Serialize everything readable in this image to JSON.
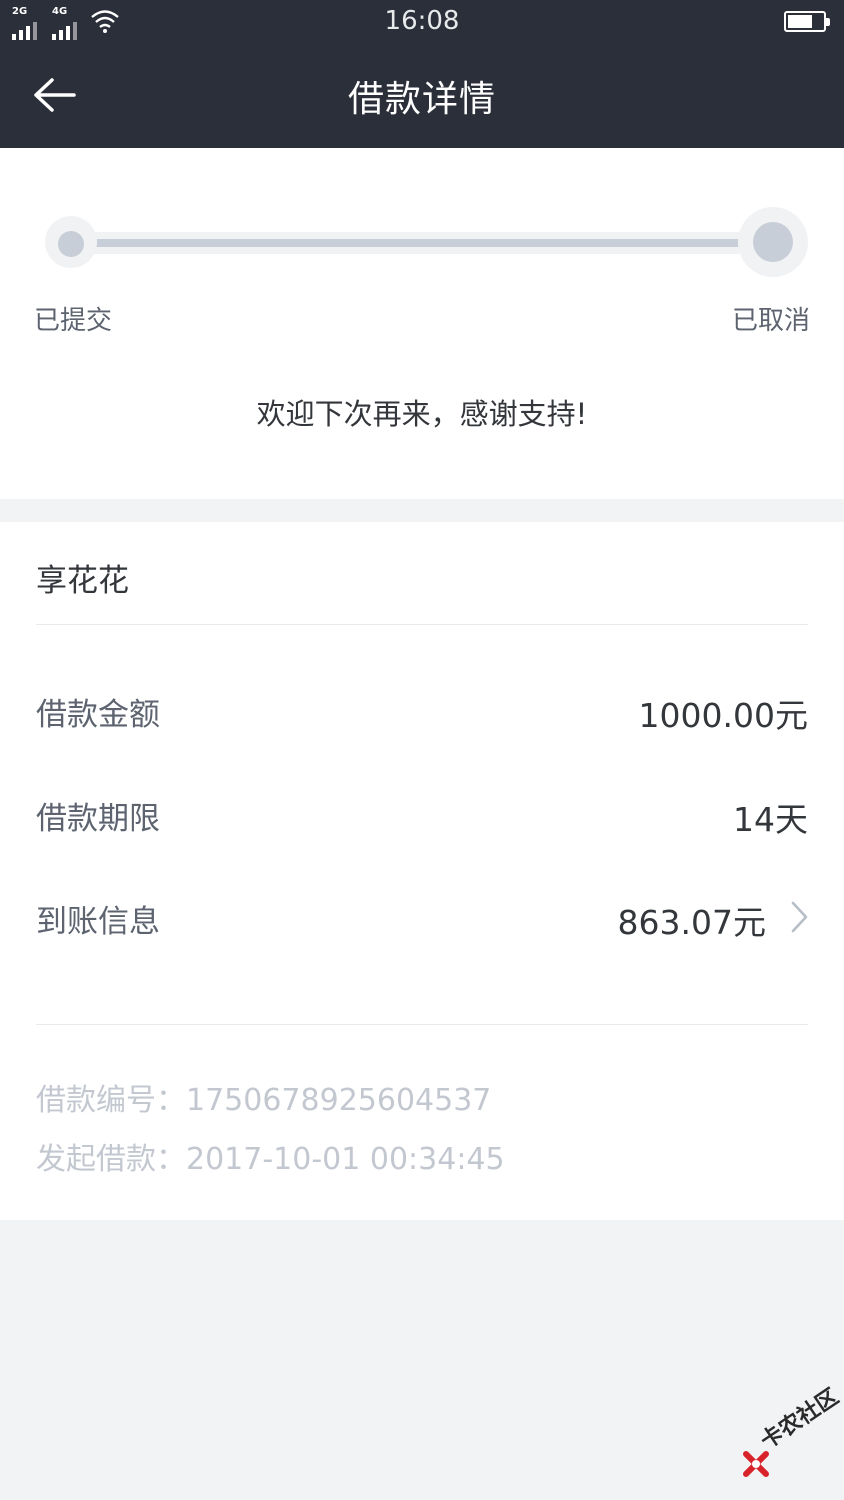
{
  "status_bar": {
    "signal_1_label": "2G",
    "signal_2_label": "4G",
    "time": "16:08",
    "icons": [
      "signal-icon",
      "signal-icon",
      "wifi-icon",
      "battery-icon"
    ]
  },
  "header": {
    "title": "借款详情",
    "back_icon": "back-arrow-icon"
  },
  "progress": {
    "steps": [
      {
        "label": "已提交"
      },
      {
        "label": "已取消"
      }
    ],
    "completed_fraction": 1.0,
    "message": "欢迎下次再来，感谢支持!"
  },
  "detail": {
    "product_name": "享花花",
    "rows": [
      {
        "label": "借款金额",
        "value": "1000.00元"
      },
      {
        "label": "借款期限",
        "value": "14天"
      },
      {
        "label": "到账信息",
        "value": "863.07元",
        "icon": "chevron-right-icon"
      }
    ],
    "loan_number": "借款编号：1750678925604537",
    "loan_started": "发起借款：2017-10-01 00:34:45"
  },
  "watermark": {
    "text": "卡农社区"
  },
  "colors": {
    "header_bg": "#2b2f39",
    "page_bg": "#f2f3f5",
    "progress": "#c7ced8",
    "meta_text": "#c3c8d0"
  }
}
